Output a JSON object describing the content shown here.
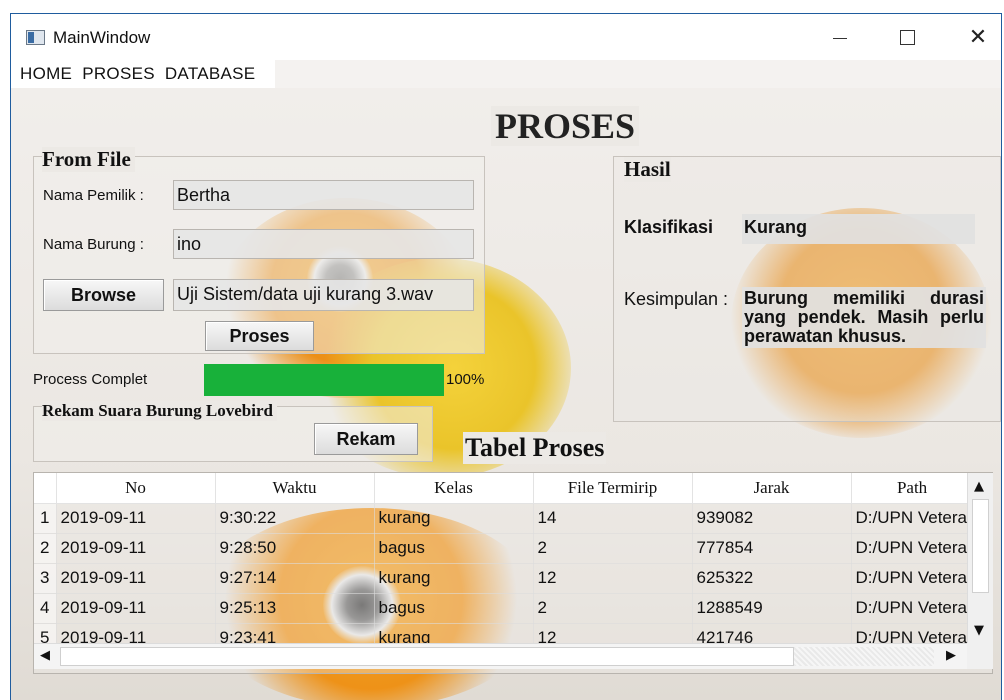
{
  "window": {
    "title": "MainWindow"
  },
  "menu": {
    "items": [
      "HOME",
      "PROSES",
      "DATABASE"
    ]
  },
  "page": {
    "title": "PROSES"
  },
  "from_file": {
    "title": "From File",
    "owner_label": "Nama Pemilik :",
    "owner_value": "Bertha",
    "bird_label": "Nama Burung :",
    "bird_value": "ino",
    "browse_label": "Browse",
    "file_value": "Uji Sistem/data uji kurang 3.wav",
    "proses_label": "Proses"
  },
  "progress": {
    "label": "Process Complet",
    "value": 100,
    "text": "100%"
  },
  "record": {
    "title": "Rekam Suara Burung Lovebird",
    "button_label": "Rekam"
  },
  "result": {
    "title": "Hasil",
    "class_label": "Klasifikasi",
    "class_value": "Kurang",
    "conclusion_label": "Kesimpulan :",
    "conclusion_value": "Burung memiliki durasi yang pendek. Masih perlu perawatan khusus."
  },
  "table": {
    "title": "Tabel Proses",
    "columns": [
      "No",
      "Waktu",
      "Kelas",
      "File Termirip",
      "Jarak",
      "Path"
    ],
    "rows": [
      [
        "1",
        "2019-09-11",
        "9:30:22",
        "kurang",
        "14",
        "939082",
        "D:/UPN Veterar"
      ],
      [
        "2",
        "2019-09-11",
        "9:28:50",
        "bagus",
        "2",
        "777854",
        "D:/UPN Veterar"
      ],
      [
        "3",
        "2019-09-11",
        "9:27:14",
        "kurang",
        "12",
        "625322",
        "D:/UPN Veterar"
      ],
      [
        "4",
        "2019-09-11",
        "9:25:13",
        "bagus",
        "2",
        "1288549",
        "D:/UPN Veterar"
      ],
      [
        "5",
        "2019-09-11",
        "9:23:41",
        "kurang",
        "12",
        "421746",
        "D:/UPN Veterar"
      ]
    ]
  },
  "icons": {
    "app": "app-window-icon",
    "minimize": "minimize-icon",
    "maximize": "maximize-icon",
    "close": "close-icon",
    "scroll_up": "scroll-up-arrow-icon",
    "scroll_down": "scroll-down-arrow-icon",
    "scroll_left": "scroll-left-arrow-icon",
    "scroll_right": "scroll-right-arrow-icon"
  },
  "colors": {
    "progress_fill": "#18b13a",
    "window_border": "#1f5c9e"
  }
}
